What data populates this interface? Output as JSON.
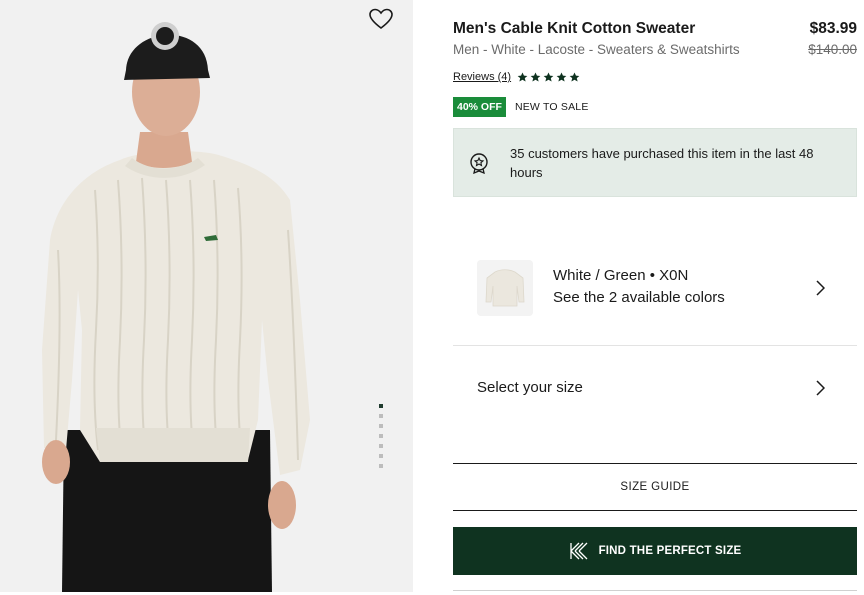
{
  "product": {
    "title": "Men's Cable Knit Cotton Sweater",
    "subtitle": "Men - White - Lacoste - Sweaters & Sweatshirts",
    "price": "$83.99",
    "old_price": "$140.00",
    "reviews_label": "Reviews (4)",
    "rating": 5,
    "rating_max": 5,
    "discount_badge": "40% OFF",
    "sale_tag": "NEW TO SALE"
  },
  "notice": {
    "text": "35 customers have purchased this item in the last 48 hours",
    "icon": "award-badge-icon"
  },
  "color": {
    "name": "White / Green • X0N",
    "link": "See the 2 available colors"
  },
  "size": {
    "label": "Select your size",
    "guide": "SIZE GUIDE"
  },
  "fit_button": {
    "label": "FIND THE PERFECT SIZE"
  },
  "gallery": {
    "image_count": 7,
    "active_index": 0
  },
  "colors": {
    "discount_green": "#1a8c3a",
    "button_dark_green": "#0f3320",
    "notice_bg": "#e4ece7"
  }
}
